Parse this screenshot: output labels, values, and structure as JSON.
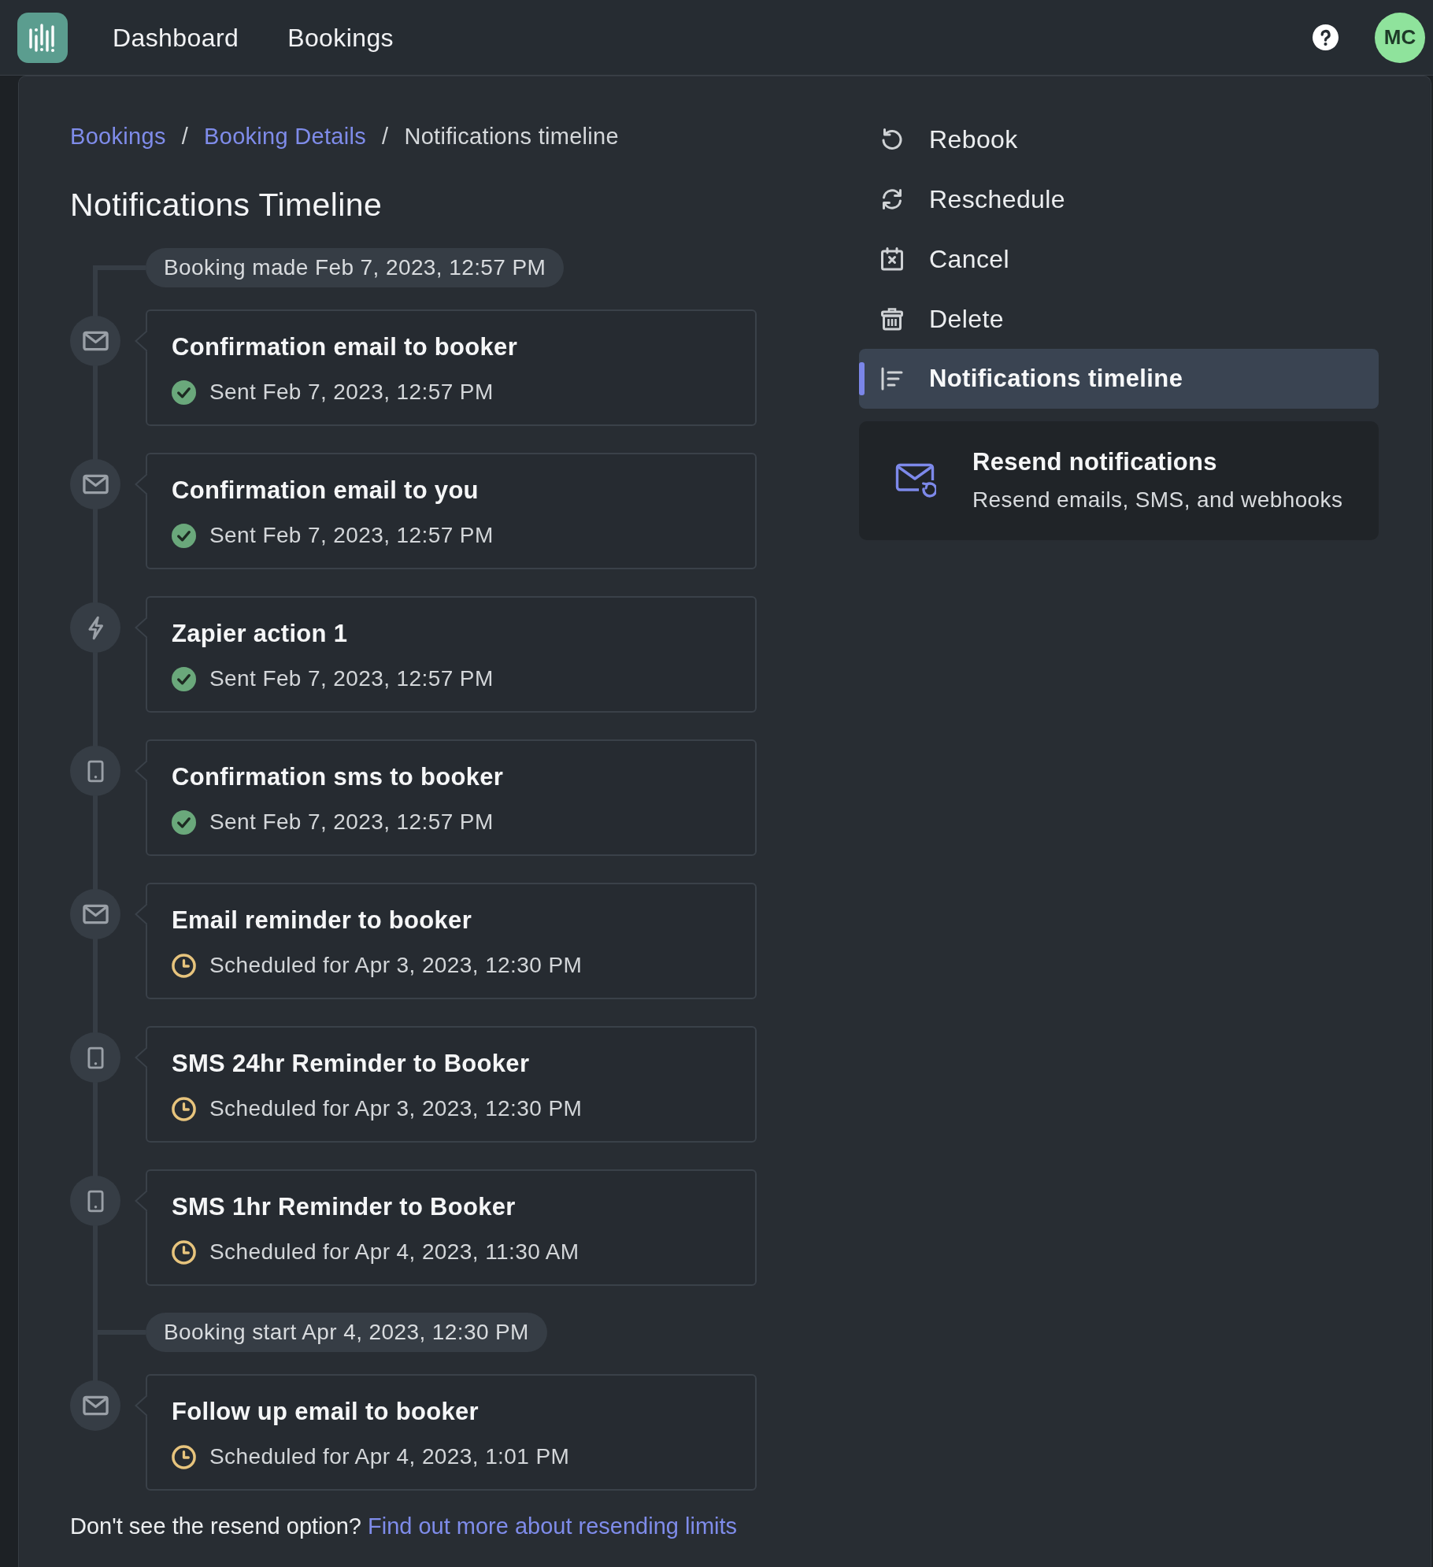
{
  "top_bar": {
    "nav": [
      {
        "label": "Dashboard"
      },
      {
        "label": "Bookings"
      }
    ],
    "avatar": {
      "initials": "MC"
    }
  },
  "breadcrumb": [
    {
      "kind": "link",
      "label": "Bookings"
    },
    {
      "kind": "separator",
      "label": "/"
    },
    {
      "kind": "link",
      "label": "Booking Details"
    },
    {
      "kind": "separator",
      "label": "/"
    },
    {
      "kind": "current",
      "label": "Notifications timeline"
    }
  ],
  "title": "Notifications Timeline",
  "timeline": [
    {
      "kind": "marker",
      "label": "Booking made Feb 7, 2023, 12:57 PM"
    },
    {
      "kind": "notification",
      "channel": {
        "kind": "email"
      },
      "title": "Confirmation email to booker",
      "status": {
        "kind": "sent",
        "text": "Sent Feb 7, 2023, 12:57 PM"
      }
    },
    {
      "kind": "notification",
      "channel": {
        "kind": "email"
      },
      "title": "Confirmation email to you",
      "status": {
        "kind": "sent",
        "text": "Sent Feb 7, 2023, 12:57 PM"
      }
    },
    {
      "kind": "notification",
      "channel": {
        "kind": "zapier"
      },
      "title": "Zapier action 1",
      "status": {
        "kind": "sent",
        "text": "Sent Feb 7, 2023, 12:57 PM"
      }
    },
    {
      "kind": "notification",
      "channel": {
        "kind": "sms"
      },
      "title": "Confirmation sms to booker",
      "status": {
        "kind": "sent",
        "text": "Sent Feb 7, 2023, 12:57 PM"
      }
    },
    {
      "kind": "notification",
      "channel": {
        "kind": "email"
      },
      "title": "Email reminder to booker",
      "status": {
        "kind": "scheduled",
        "text": "Scheduled for Apr 3, 2023, 12:30 PM"
      }
    },
    {
      "kind": "notification",
      "channel": {
        "kind": "sms"
      },
      "title": "SMS 24hr Reminder to Booker",
      "status": {
        "kind": "scheduled",
        "text": "Scheduled for Apr 3, 2023, 12:30 PM"
      }
    },
    {
      "kind": "notification",
      "channel": {
        "kind": "sms"
      },
      "title": "SMS 1hr Reminder to Booker",
      "status": {
        "kind": "scheduled",
        "text": "Scheduled for Apr 4, 2023, 11:30 AM"
      }
    },
    {
      "kind": "marker",
      "label": "Booking start Apr 4, 2023, 12:30 PM"
    },
    {
      "kind": "notification",
      "channel": {
        "kind": "email"
      },
      "title": "Follow up email to booker",
      "status": {
        "kind": "scheduled",
        "text": "Scheduled for Apr 4, 2023, 1:01 PM"
      }
    }
  ],
  "footer": {
    "text": "Don't see the resend option?",
    "link": "Find out more about resending limits"
  },
  "actions": [
    {
      "kind": "rebook",
      "label": "Rebook",
      "selected": false
    },
    {
      "kind": "reschedule",
      "label": "Reschedule",
      "selected": false
    },
    {
      "kind": "cancel",
      "label": "Cancel",
      "selected": false
    },
    {
      "kind": "delete",
      "label": "Delete",
      "selected": false
    },
    {
      "kind": "timeline",
      "label": "Notifications timeline",
      "selected": true
    }
  ],
  "resend_card": {
    "title": "Resend notifications",
    "subtitle": "Resend emails, SMS, and webhooks"
  }
}
